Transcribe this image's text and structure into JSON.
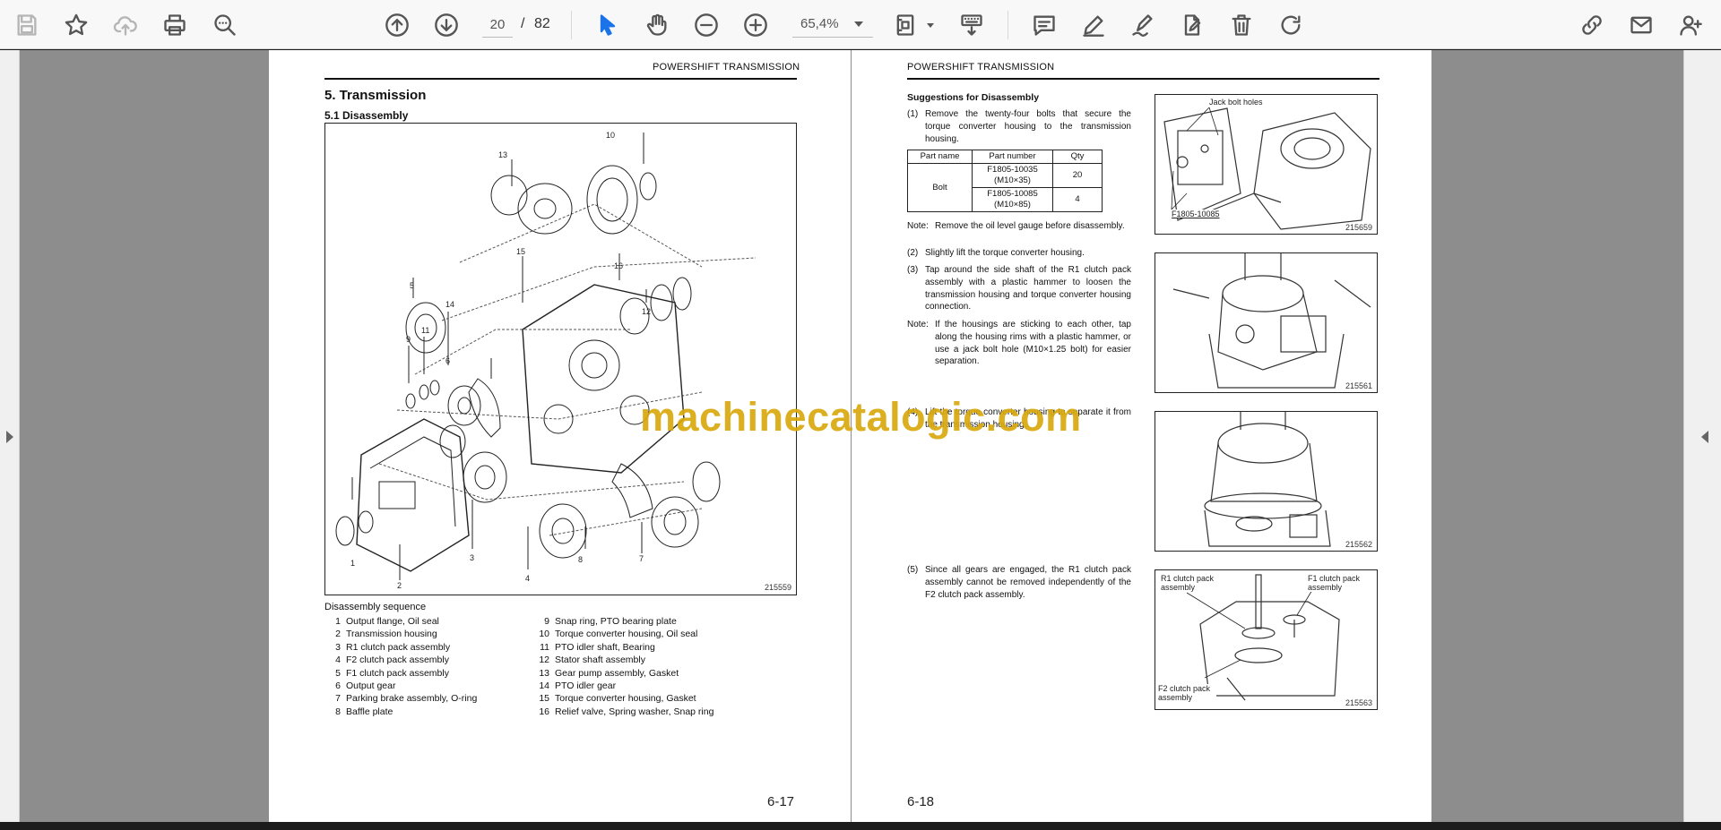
{
  "toolbar": {
    "page_current": "20",
    "page_separator": "/",
    "page_total": "82",
    "zoom": "65,4%"
  },
  "left_page": {
    "header": "POWERSHIFT TRANSMISSION",
    "section_title": "5.  Transmission",
    "subsection_title": "5.1   Disassembly",
    "figure": {
      "id": "215559",
      "callouts": [
        "1",
        "2",
        "3",
        "4",
        "5",
        "6",
        "7",
        "8",
        "9",
        "10",
        "11",
        "12",
        "13",
        "14",
        "15",
        "16"
      ]
    },
    "sequence_title": "Disassembly sequence",
    "sequence_left": [
      {
        "n": "1",
        "text": "Output flange, Oil seal"
      },
      {
        "n": "2",
        "text": "Transmission housing"
      },
      {
        "n": "3",
        "text": "R1 clutch pack assembly"
      },
      {
        "n": "4",
        "text": "F2 clutch pack assembly"
      },
      {
        "n": "5",
        "text": "F1 clutch pack assembly"
      },
      {
        "n": "6",
        "text": "Output gear"
      },
      {
        "n": "7",
        "text": "Parking brake assembly, O-ring"
      },
      {
        "n": "8",
        "text": "Baffle plate"
      }
    ],
    "sequence_right": [
      {
        "n": "9",
        "text": "Snap ring, PTO bearing plate"
      },
      {
        "n": "10",
        "text": "Torque converter housing, Oil seal"
      },
      {
        "n": "11",
        "text": "PTO idler shaft, Bearing"
      },
      {
        "n": "12",
        "text": "Stator shaft assembly"
      },
      {
        "n": "13",
        "text": "Gear pump assembly, Gasket"
      },
      {
        "n": "14",
        "text": "PTO idler gear"
      },
      {
        "n": "15",
        "text": "Torque converter housing, Gasket"
      },
      {
        "n": "16",
        "text": "Relief valve, Spring washer, Snap ring"
      }
    ],
    "page_number": "6-17"
  },
  "right_page": {
    "header": "POWERSHIFT TRANSMISSION",
    "title": "Suggestions for Disassembly",
    "step1": {
      "n": "(1)",
      "text": "Remove the twenty-four bolts that secure the torque converter housing to the transmission housing."
    },
    "table": {
      "headers": [
        "Part name",
        "Part number",
        "Qty"
      ],
      "part_name": "Bolt",
      "rows": [
        {
          "number": "F1805-10035",
          "size": "(M10×35)",
          "qty": "20"
        },
        {
          "number": "F1805-10085",
          "size": "(M10×85)",
          "qty": "4"
        }
      ]
    },
    "note1": {
      "label": "Note:",
      "text": "Remove the oil level gauge before disassembly."
    },
    "step2": {
      "n": "(2)",
      "text": "Slightly lift the torque converter housing."
    },
    "step3": {
      "n": "(3)",
      "text": "Tap around the side shaft of the R1 clutch pack assembly with a plastic hammer to loosen the transmission housing and torque converter housing connection."
    },
    "note2": {
      "label": "Note:",
      "text": "If the housings are sticking to each other, tap along the housing rims with a plastic hammer, or use a jack bolt hole (M10×1.25 bolt) for easier separation."
    },
    "step4": {
      "n": "(4)",
      "text": "Lift the torque converter housing to separate it from the transmission housing."
    },
    "step5": {
      "n": "(5)",
      "text": "Since all gears are engaged, the R1 clutch pack assembly cannot be removed independently of the F2 clutch pack assembly."
    },
    "figures": [
      {
        "id": "215559b",
        "label_id": "215659",
        "labels": [
          "Jack bolt holes",
          "F1805-10085"
        ]
      },
      {
        "label_id": "215561"
      },
      {
        "label_id": "215562"
      },
      {
        "label_id": "215563",
        "labels": [
          "R1 clutch pack assembly",
          "F1 clutch pack assembly",
          "F2 clutch pack assembly"
        ]
      }
    ],
    "page_number": "6-18"
  },
  "watermark": "machinecatalogic.com"
}
